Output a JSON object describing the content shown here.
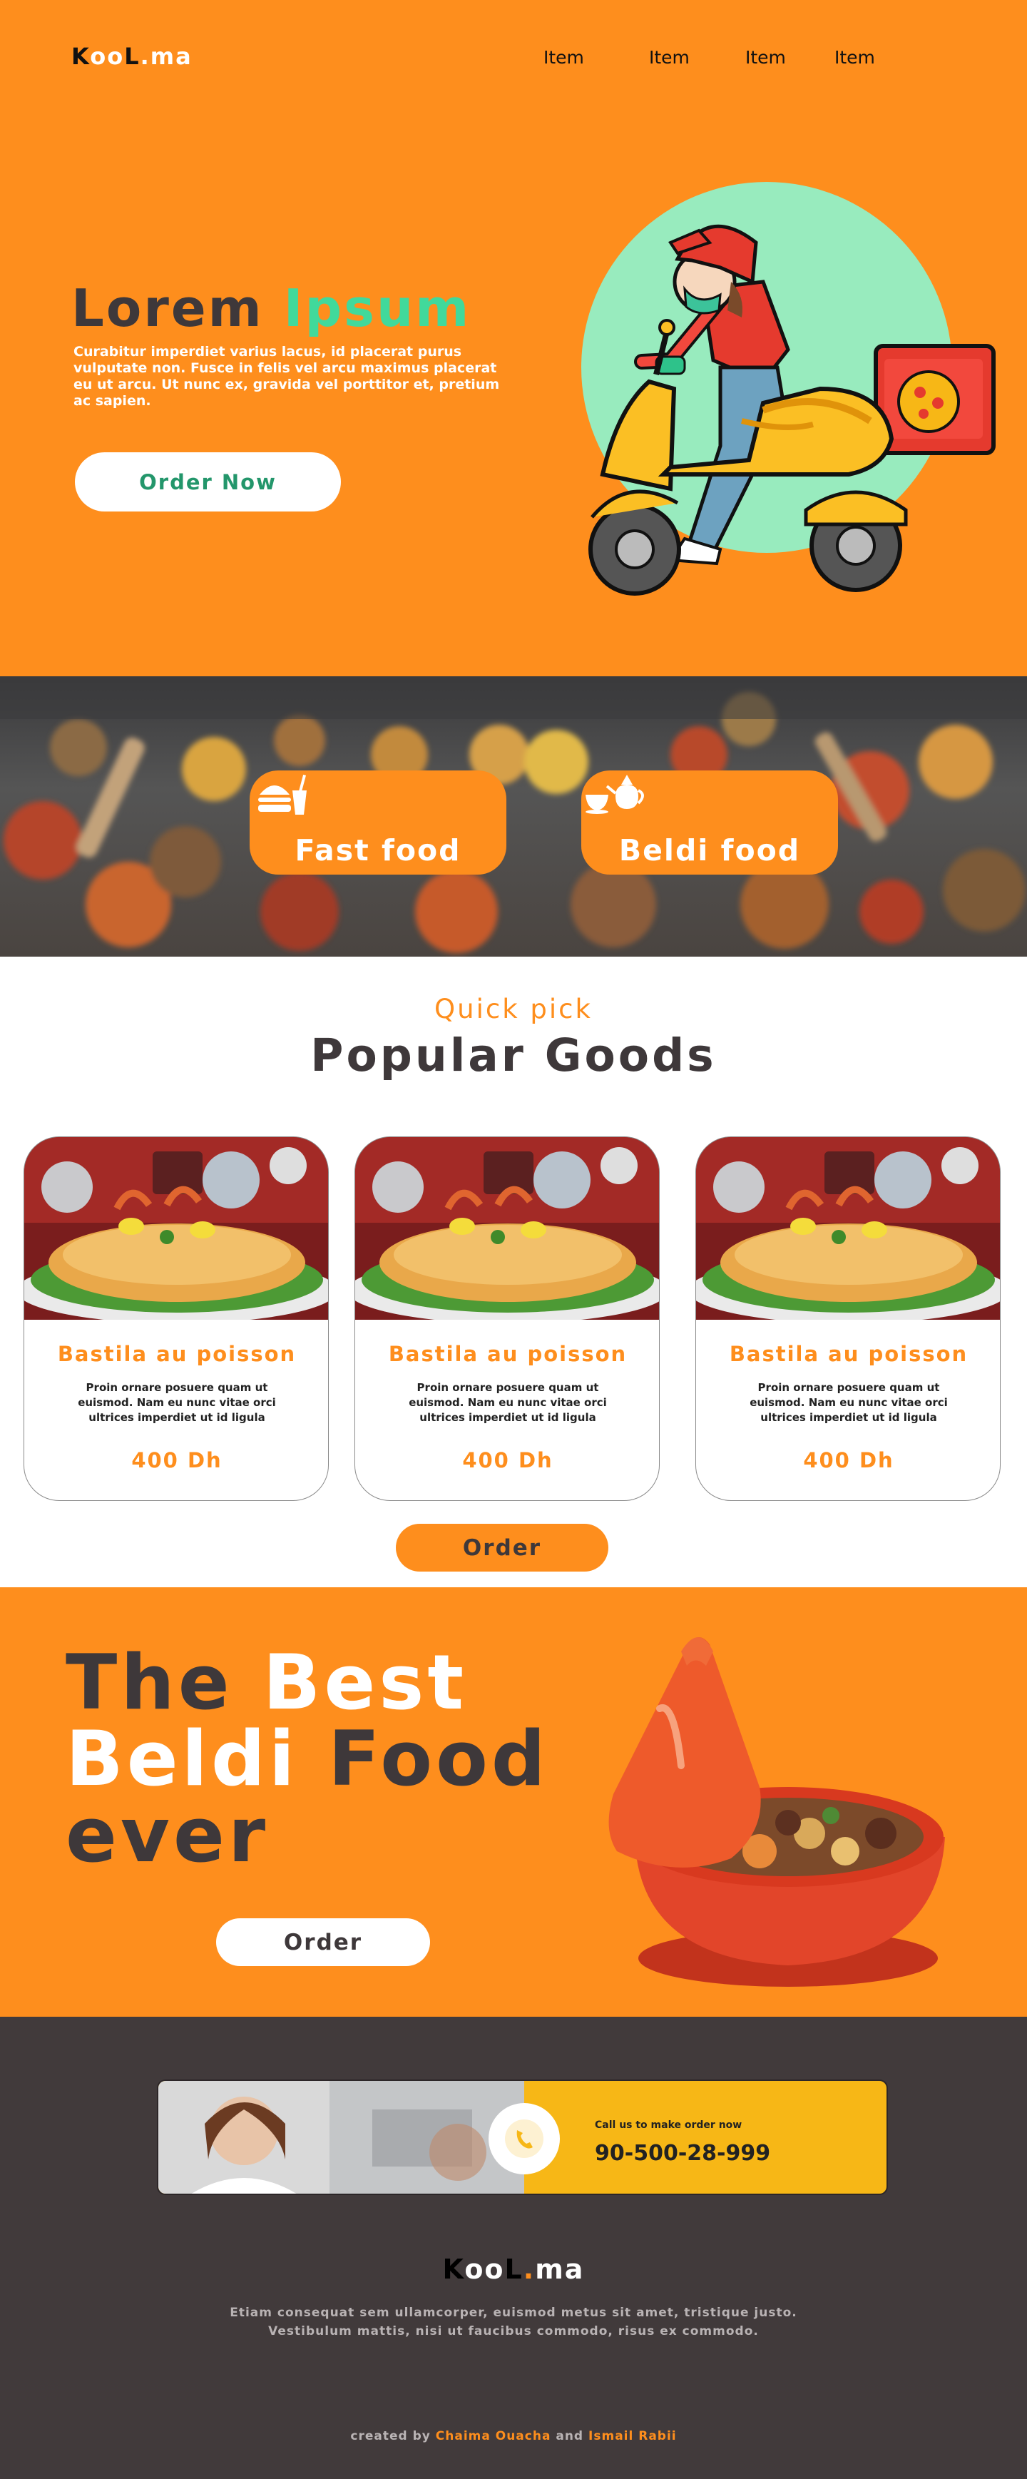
{
  "brand": {
    "logo_k": "K",
    "logo_oo": "oo",
    "logo_l": "L",
    "logo_dot": ".",
    "logo_ma": "ma"
  },
  "nav": {
    "items": [
      "Item",
      "Item",
      "Item",
      "Item"
    ]
  },
  "hero": {
    "title_dark": "Lorem",
    "title_accent": "Ipsum",
    "text": "Curabitur imperdiet varius lacus, id placerat purus vulputate non. Fusce in felis vel arcu maximus placerat eu ut arcu. Ut nunc ex, gravida vel porttitor et, pretium ac sapien.",
    "cta": "Order Now"
  },
  "categories": [
    {
      "label": "Fast food",
      "icon": "burger-drink-icon"
    },
    {
      "label": "Beldi food",
      "icon": "teapot-icon"
    }
  ],
  "popular": {
    "kicker": "Quick pick",
    "title": "Popular Goods",
    "cards": [
      {
        "name": "Bastila au poisson",
        "desc": "Proin ornare posuere quam ut euismod. Nam eu nunc vitae orci ultrices imperdiet ut id ligula",
        "price": "400 Dh"
      },
      {
        "name": "Bastila au poisson",
        "desc": "Proin ornare posuere quam ut euismod. Nam eu nunc vitae orci ultrices imperdiet ut id ligula",
        "price": "400 Dh"
      },
      {
        "name": "Bastila au poisson",
        "desc": "Proin ornare posuere quam ut euismod. Nam eu nunc vitae orci ultrices imperdiet ut id ligula",
        "price": "400 Dh"
      }
    ],
    "order": "Order"
  },
  "best": {
    "line1_dark": "The",
    "line1_white": "Best",
    "line2_white": "Beldi",
    "line2_dark": "Food",
    "line3_dark": "ever",
    "order": "Order"
  },
  "call": {
    "small": "Call us to make order now",
    "number": "90-500-28-999"
  },
  "footer": {
    "text_line1": "Etiam consequat sem ullamcorper, euismod metus sit amet, tristique justo.",
    "text_line2": "Vestibulum mattis, nisi ut faucibus commodo, risus ex commodo.",
    "credits_prefix": "created by",
    "author1": "Chaima Ouacha",
    "credits_and": "and",
    "author2": "Ismail Rabii"
  },
  "colors": {
    "orange": "#fe8e1d",
    "dark": "#3e383a",
    "green": "#41d99b",
    "footer": "#413a3b",
    "yellow": "#f7b716"
  }
}
